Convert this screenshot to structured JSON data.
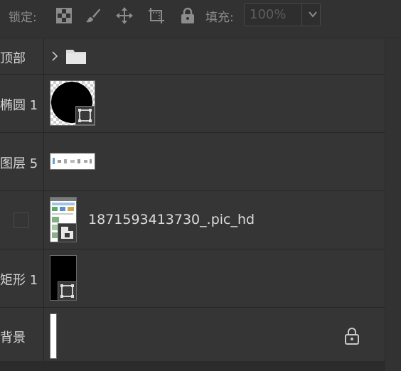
{
  "toolbar": {
    "lock_label": "锁定:",
    "fill_label": "填充:",
    "fill_value": "100%",
    "icons": [
      "checkerboard-lock-icon",
      "brush-icon",
      "move-icon",
      "artboard-icon",
      "lock-icon"
    ]
  },
  "layers": [
    {
      "name": "顶部",
      "type": "group"
    },
    {
      "name": "椭圆 1",
      "type": "shape-ellipse"
    },
    {
      "name": "图层 5",
      "type": "pixel"
    },
    {
      "name": "1871593413730_.pic_hd",
      "type": "image",
      "hidden": true
    },
    {
      "name": "矩形 1",
      "type": "shape-rect"
    },
    {
      "name": "背景",
      "type": "background",
      "locked": true
    }
  ],
  "colors": {
    "panel_bg": "#323232",
    "row_bg": "#353535",
    "text": "#d6d6d6",
    "muted": "#8c8c8c"
  }
}
